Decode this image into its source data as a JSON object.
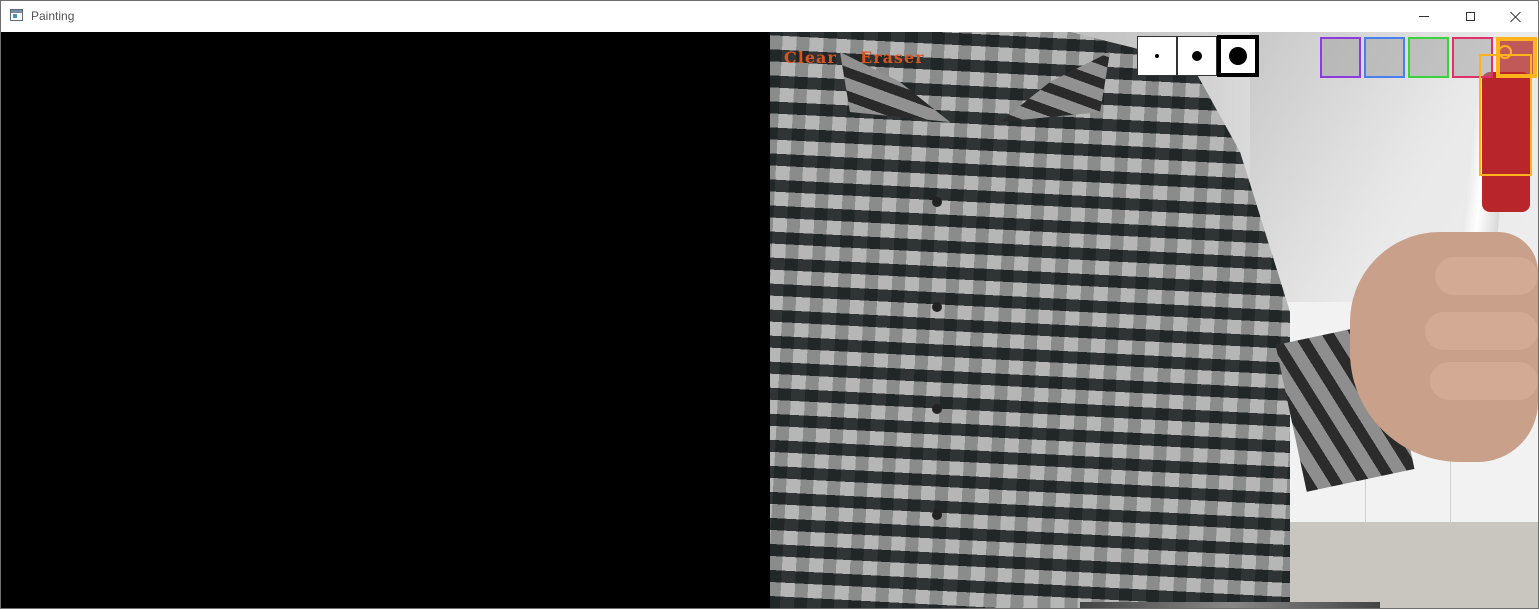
{
  "window": {
    "title": "Painting",
    "icon": "app-window-icon",
    "controls": [
      "minimize-icon",
      "maximize-icon",
      "close-icon"
    ]
  },
  "toolbar": {
    "clear_label": "Clear",
    "eraser_label": "Eraser",
    "text_color": "#d9541e",
    "brush_sizes": [
      "small",
      "medium",
      "large"
    ],
    "selected_brush_size": "large",
    "colors": [
      {
        "name": "purple",
        "hex": "#8c3cdc"
      },
      {
        "name": "blue",
        "hex": "#4a7ff0"
      },
      {
        "name": "green",
        "hex": "#3cd23c"
      },
      {
        "name": "pink",
        "hex": "#e0306a"
      },
      {
        "name": "orange",
        "hex": "#ffb41e"
      }
    ],
    "selected_color": "orange"
  },
  "panes": {
    "left": "drawing canvas",
    "right": "camera feed"
  }
}
